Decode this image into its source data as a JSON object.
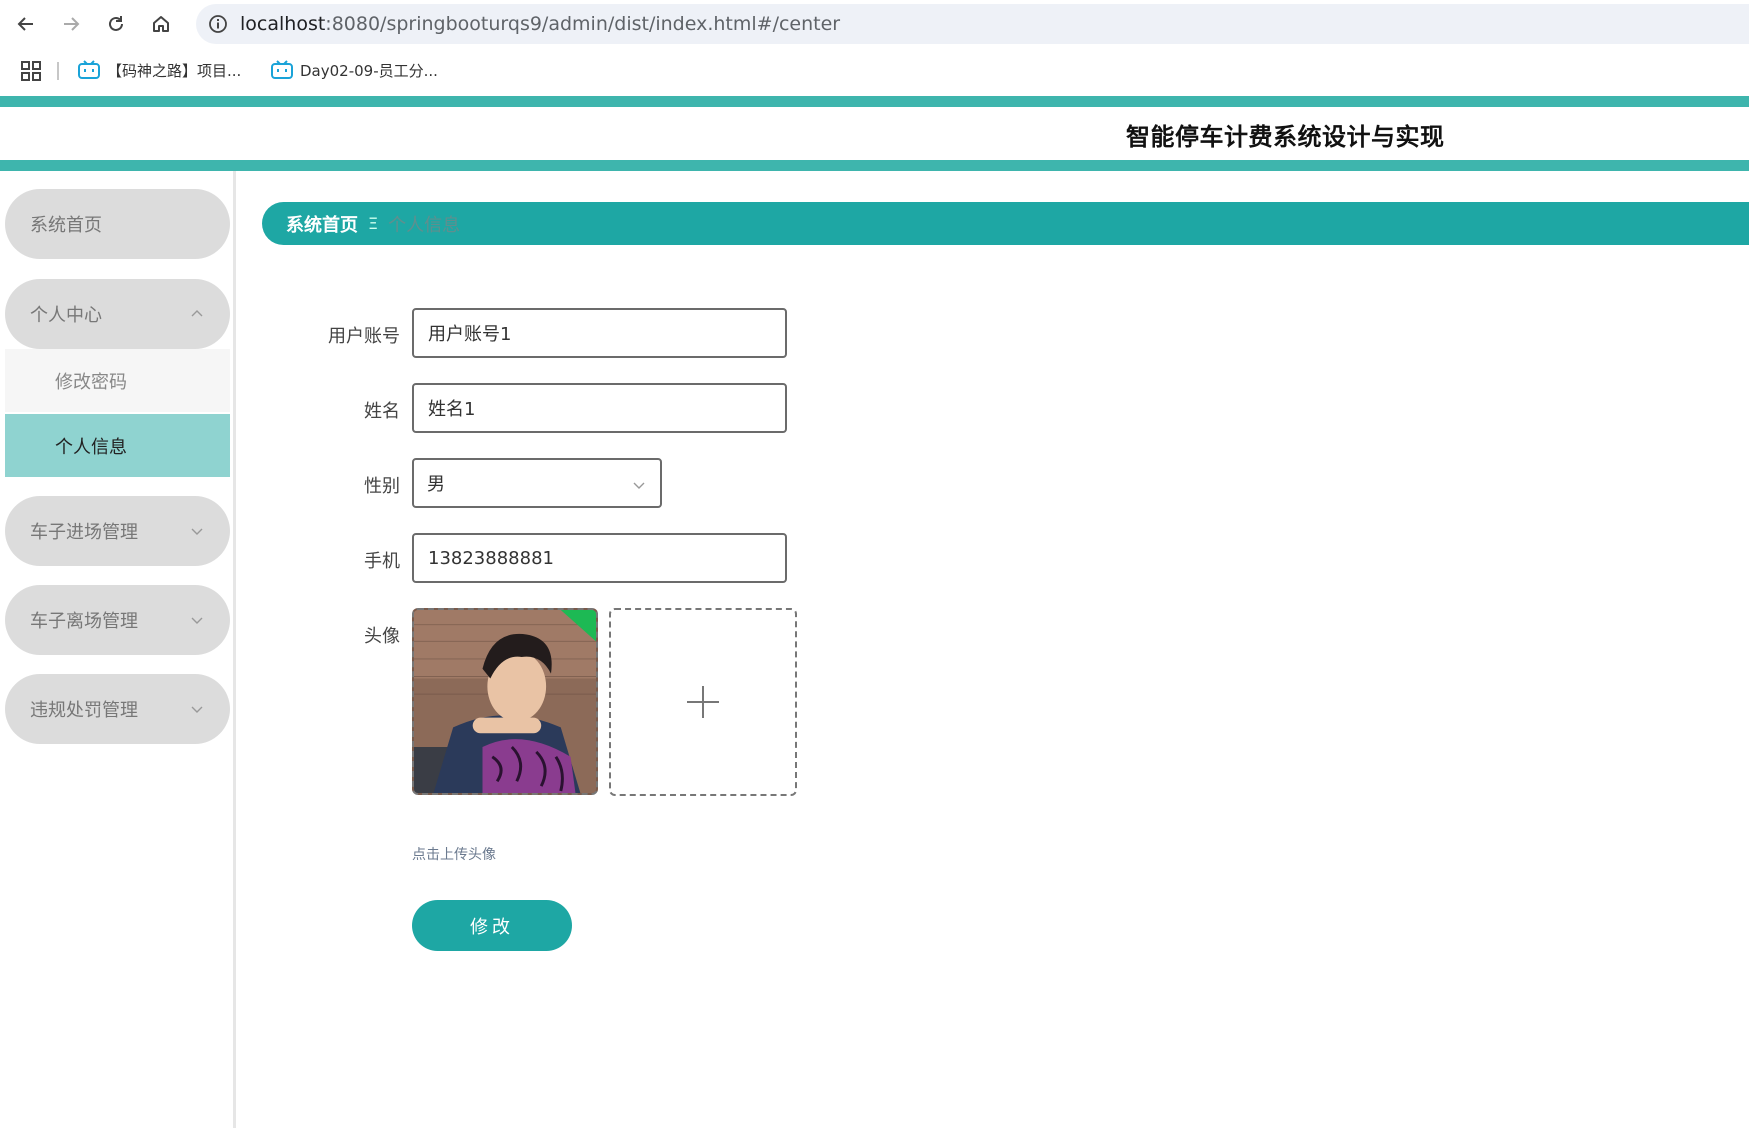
{
  "browser": {
    "url_host": "localhost",
    "url_path": ":8080/springbooturqs9/admin/dist/index.html#/center",
    "bookmarks": [
      {
        "label": "【码神之路】项目..."
      },
      {
        "label": "Day02-09-员工分..."
      }
    ]
  },
  "header": {
    "title": "智能停车计费系统设计与实现"
  },
  "sidebar": {
    "items": [
      {
        "label": "系统首页"
      },
      {
        "label": "个人中心"
      },
      {
        "label": "修改密码"
      },
      {
        "label": "个人信息"
      },
      {
        "label": "车子进场管理"
      },
      {
        "label": "车子离场管理"
      },
      {
        "label": "违规处罚管理"
      }
    ]
  },
  "breadcrumb": {
    "home": "系统首页",
    "separator": "Ξ",
    "current": "个人信息"
  },
  "form": {
    "account_label": "用户账号",
    "account_value": "用户账号1",
    "name_label": "姓名",
    "name_value": "姓名1",
    "gender_label": "性别",
    "gender_value": "男",
    "phone_label": "手机",
    "phone_value": "13823888881",
    "avatar_label": "头像",
    "upload_hint": "点击上传头像",
    "submit_label": "修改"
  },
  "colors": {
    "accent": "#1ea7a4",
    "stripe": "#3eb5ad",
    "active_menu": "#8fd3d0",
    "menu_pill": "#dcdcdc"
  },
  "icons": [
    "back-icon",
    "forward-icon",
    "reload-icon",
    "home-icon",
    "info-icon",
    "apps-icon",
    "bookmark-tv-icon",
    "chevron-up-icon",
    "chevron-down-icon",
    "plus-icon"
  ]
}
